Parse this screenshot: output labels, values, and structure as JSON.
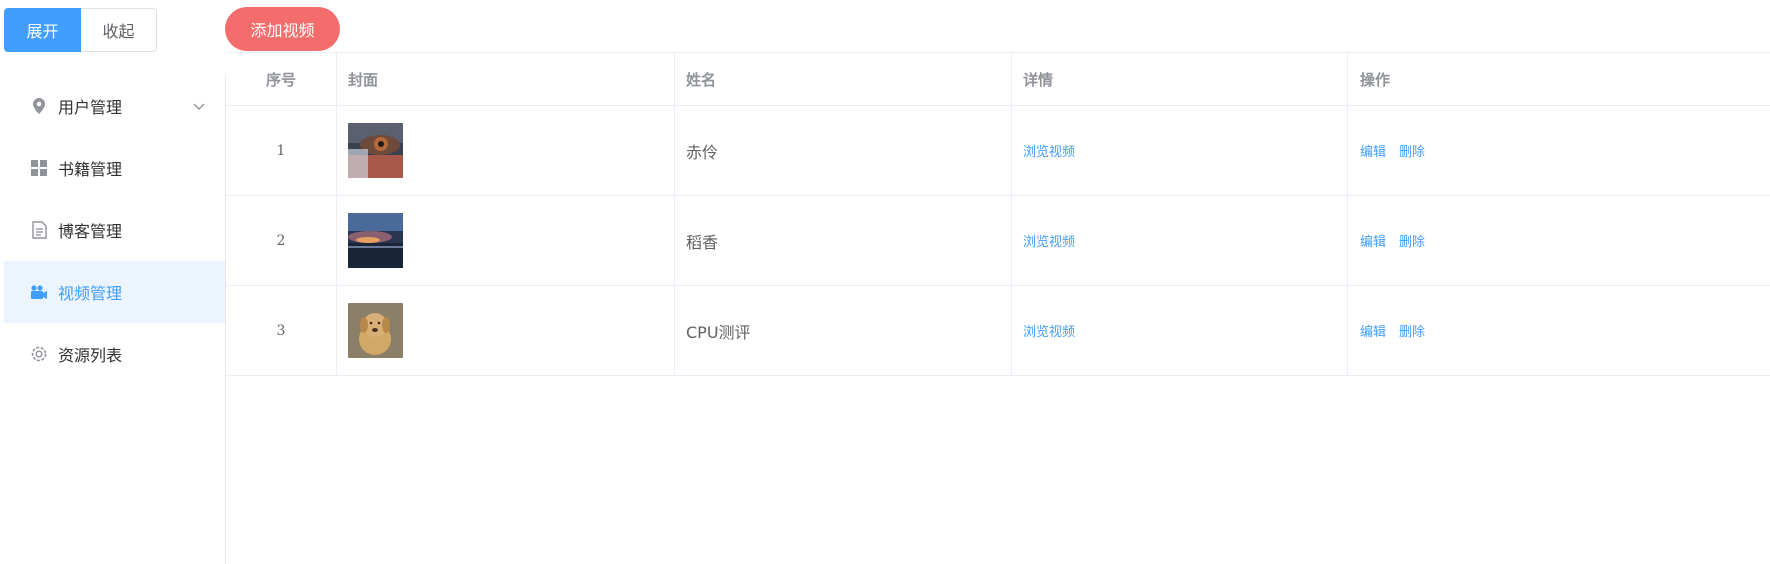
{
  "toolbar": {
    "expand_label": "展开",
    "collapse_label": "收起"
  },
  "sidebar": {
    "items": [
      {
        "label": "用户管理",
        "icon": "location-pin-icon"
      },
      {
        "label": "书籍管理",
        "icon": "grid-icon"
      },
      {
        "label": "博客管理",
        "icon": "document-icon"
      },
      {
        "label": "视频管理",
        "icon": "video-camera-icon",
        "active": true
      },
      {
        "label": "资源列表",
        "icon": "gear-icon"
      }
    ]
  },
  "add_button": {
    "label": "添加视频"
  },
  "table": {
    "headers": [
      "序号",
      "封面",
      "姓名",
      "详情",
      "操作"
    ],
    "rows": [
      {
        "index": "1",
        "name": "赤伶",
        "detail": "浏览视频",
        "edit": "编辑",
        "delete": "删除"
      },
      {
        "index": "2",
        "name": "稻香",
        "detail": "浏览视频",
        "edit": "编辑",
        "delete": "删除"
      },
      {
        "index": "3",
        "name": "CPU测评",
        "detail": "浏览视频",
        "edit": "编辑",
        "delete": "删除"
      }
    ]
  },
  "colors": {
    "primary": "#409eff",
    "danger": "#f56c6c",
    "active_bg": "#ecf5ff"
  }
}
